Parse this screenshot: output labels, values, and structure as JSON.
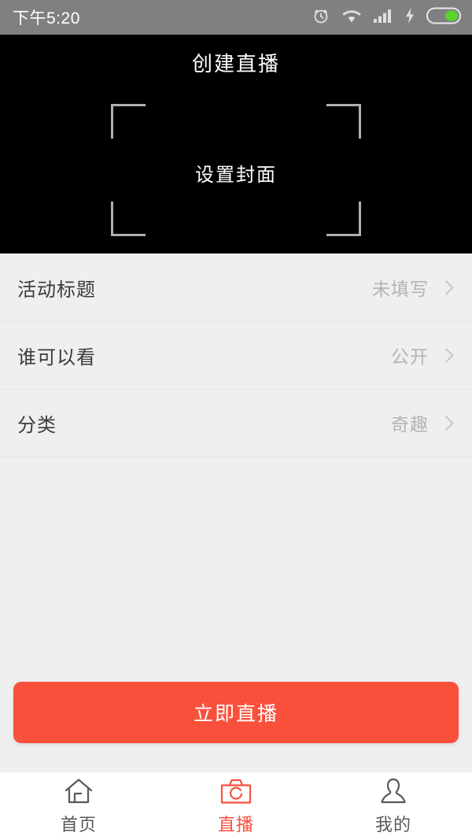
{
  "status_bar": {
    "time": "下午5:20",
    "icons": [
      "alarm-icon",
      "wifi-icon",
      "signal-icon",
      "charging-icon",
      "battery-icon"
    ],
    "background": "#808080",
    "text_color": "#ffffff"
  },
  "header": {
    "title": "创建直播",
    "background": "#000000"
  },
  "cover": {
    "hint": "设置封面",
    "frame_color": "#b0b0b0"
  },
  "list": {
    "rows": [
      {
        "label": "活动标题",
        "value": "未填写"
      },
      {
        "label": "谁可以看",
        "value": "公开"
      },
      {
        "label": "分类",
        "value": "奇趣"
      }
    ]
  },
  "cta": {
    "label": "立即直播",
    "color": "#f9503c"
  },
  "tabbar": {
    "active_color": "#f9503c",
    "inactive_color": "#595959",
    "tabs": [
      {
        "label": "首页",
        "icon": "home-icon",
        "active": false
      },
      {
        "label": "直播",
        "icon": "camera-icon",
        "active": true
      },
      {
        "label": "我的",
        "icon": "person-icon",
        "active": false
      }
    ]
  }
}
